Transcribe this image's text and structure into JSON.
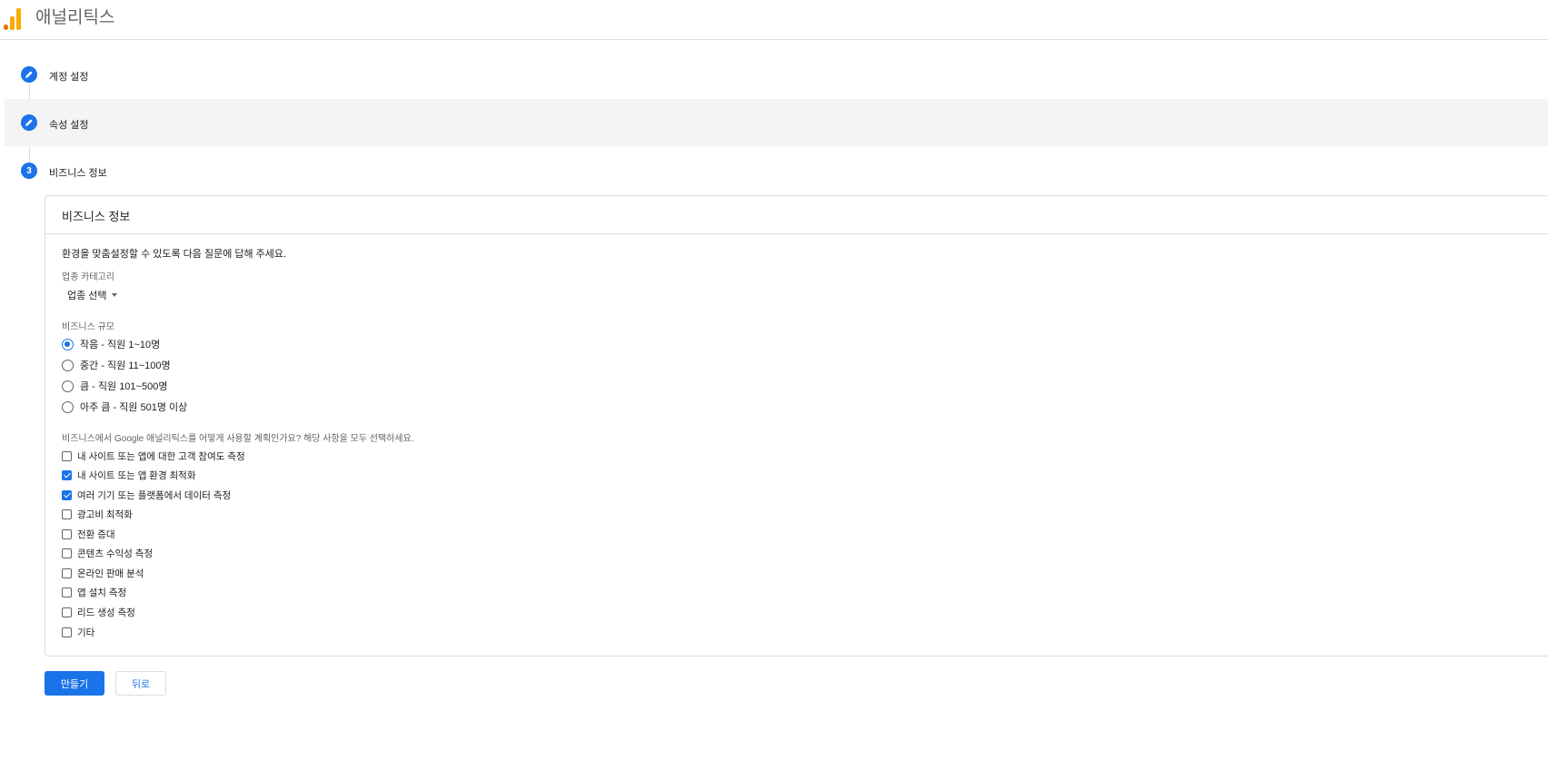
{
  "header": {
    "app_title": "애널리틱스"
  },
  "steps": [
    {
      "label": "계정 설정",
      "state": "done"
    },
    {
      "label": "속성 설정",
      "state": "done"
    },
    {
      "label": "비즈니스 정보",
      "state": "current",
      "number": "3"
    }
  ],
  "card": {
    "title": "비즈니스 정보",
    "instruction": "환경을 맞춤설정할 수 있도록 다음 질문에 답해 주세요.",
    "industry": {
      "label": "업종 카테고리",
      "selected": "업종 선택"
    },
    "size": {
      "label": "비즈니스 규모",
      "options": [
        {
          "label": "작음 - 직원 1~10명",
          "checked": true
        },
        {
          "label": "중간 - 직원 11~100명",
          "checked": false
        },
        {
          "label": "큼 - 직원 101~500명",
          "checked": false
        },
        {
          "label": "아주 큼 - 직원 501명 이상",
          "checked": false
        }
      ]
    },
    "usage": {
      "label": "비즈니스에서 Google 애널리틱스를 어떻게 사용할 계획인가요? 해당 사항을 모두 선택하세요.",
      "options": [
        {
          "label": "내 사이트 또는 앱에 대한 고객 참여도 측정",
          "checked": false
        },
        {
          "label": "내 사이트 또는 앱 환경 최적화",
          "checked": true
        },
        {
          "label": "여러 기기 또는 플랫폼에서 데이터 측정",
          "checked": true
        },
        {
          "label": "광고비 최적화",
          "checked": false
        },
        {
          "label": "전환 증대",
          "checked": false
        },
        {
          "label": "콘텐츠 수익성 측정",
          "checked": false
        },
        {
          "label": "온라인 판매 분석",
          "checked": false
        },
        {
          "label": "앱 설치 측정",
          "checked": false
        },
        {
          "label": "리드 생성 측정",
          "checked": false
        },
        {
          "label": "기타",
          "checked": false
        }
      ]
    }
  },
  "actions": {
    "create_label": "만들기",
    "back_label": "뒤로"
  },
  "colors": {
    "accent": "#1a73e8",
    "logo_orange": "#f9ab00",
    "logo_dark": "#e37400"
  },
  "icons": {
    "step_done": "pencil-icon",
    "dropdown": "caret-down-icon"
  }
}
